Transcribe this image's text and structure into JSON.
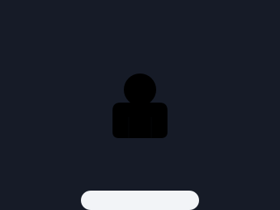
{
  "screen": {
    "avatar_icon": "user-silhouette-icon",
    "action_label": ""
  },
  "colors": {
    "background": "#161b27",
    "avatar": "#000000",
    "pill": "#f2f4f7"
  }
}
